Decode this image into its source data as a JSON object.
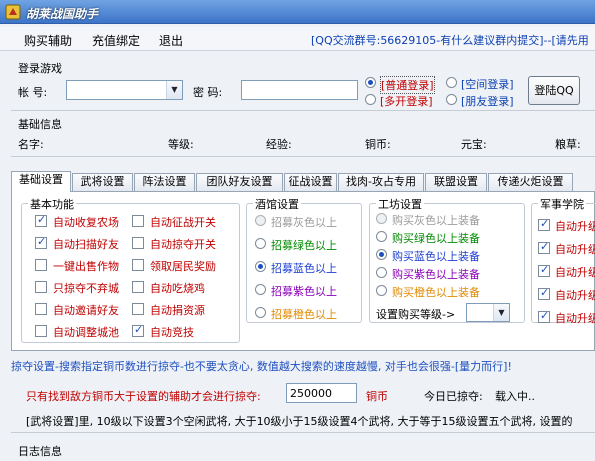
{
  "window": {
    "title": "胡莱战国助手"
  },
  "menu": {
    "items": [
      "购买辅助",
      "充值绑定",
      "退出"
    ],
    "qq_info": "[QQ交流群号:56629105-有什么建议群内提交]--[请先用"
  },
  "login": {
    "section": "登录游戏",
    "account_label": "帐  号:",
    "password_label": "密  码:",
    "options": [
      {
        "label": "[普通登录]",
        "selected": true,
        "color": "#c00000"
      },
      {
        "label": "[多开登录]",
        "selected": false,
        "color": "#c00000"
      },
      {
        "label": "[空间登录]",
        "selected": false,
        "color": "#0b3fb0"
      },
      {
        "label": "[朋友登录]",
        "selected": false,
        "color": "#0b3fb0"
      }
    ],
    "login_button": "登陆QQ"
  },
  "basic_info": {
    "section": "基础信息",
    "fields": [
      "名字:",
      "等级:",
      "经验:",
      "铜币:",
      "元宝:",
      "粮草:"
    ]
  },
  "tabs": [
    "基础设置",
    "武将设置",
    "阵法设置",
    "团队好友设置",
    "征战设置",
    "找肉-攻占专用",
    "联盟设置",
    "传递火炬设置"
  ],
  "basic_functions": {
    "title": "基本功能",
    "col1": [
      {
        "label": "自动收复农场",
        "checked": true
      },
      {
        "label": "自动扫描好友",
        "checked": true
      },
      {
        "label": "一键出售作物",
        "checked": false
      },
      {
        "label": "只掠夺不弃城",
        "checked": false
      },
      {
        "label": "自动邀请好友",
        "checked": false
      },
      {
        "label": "自动调整城池",
        "checked": false
      }
    ],
    "col2": [
      {
        "label": "自动征战开关",
        "checked": false
      },
      {
        "label": "自动掠夺开关",
        "checked": false
      },
      {
        "label": "领取居民奖励",
        "checked": false
      },
      {
        "label": "自动吃烧鸡",
        "checked": false
      },
      {
        "label": "自动捐资源",
        "checked": false
      },
      {
        "label": "自动竞技",
        "checked": true
      }
    ]
  },
  "tavern": {
    "title": "酒馆设置",
    "options": [
      {
        "label": "招募灰色以上",
        "color": "#9a9a9a",
        "selected": false,
        "disabled": true
      },
      {
        "label": "招募绿色以上",
        "color": "#008a00",
        "selected": false,
        "disabled": false
      },
      {
        "label": "招募蓝色以上",
        "color": "#1d3fd0",
        "selected": true,
        "disabled": false
      },
      {
        "label": "招募紫色以上",
        "color": "#8b00b8",
        "selected": false,
        "disabled": false
      },
      {
        "label": "招募橙色以上",
        "color": "#e08a00",
        "selected": false,
        "disabled": false
      }
    ]
  },
  "workshop": {
    "title": "工坊设置",
    "options": [
      {
        "label": "购买灰色以上装备",
        "color": "#9a9a9a",
        "selected": false,
        "disabled": true
      },
      {
        "label": "购买绿色以上装备",
        "color": "#008a00",
        "selected": false,
        "disabled": false
      },
      {
        "label": "购买蓝色以上装备",
        "color": "#1d3fd0",
        "selected": true,
        "disabled": false
      },
      {
        "label": "购买紫色以上装备",
        "color": "#8b00b8",
        "selected": false,
        "disabled": false
      },
      {
        "label": "购买橙色以上装备",
        "color": "#e08a00",
        "selected": false,
        "disabled": false
      }
    ],
    "level_label": "设置购买等级->"
  },
  "academy": {
    "title": "军事学院",
    "items": [
      {
        "label": "自动升级",
        "checked": true
      },
      {
        "label": "自动升级",
        "checked": true
      },
      {
        "label": "自动升级",
        "checked": true
      },
      {
        "label": "自动升级",
        "checked": true
      },
      {
        "label": "自动升级",
        "checked": true
      }
    ]
  },
  "plunder": {
    "info": "掠夺设置-搜索指定铜币数进行掠夺-也不要太贪心, 数值越大搜索的速度越慢, 对手也会很强-[量力而行]!",
    "condition_label": "只有找到敌方铜币大于设置的辅助才会进行掠夺:",
    "amount": "250000",
    "unit": "铜币",
    "today_label": "今日已掠夺:",
    "today_value": "载入中.."
  },
  "general_info": "[武将设置]里, 10级以下设置3个空闲武将, 大于10级小于15级设置4个武将, 大于等于15级设置五个武将, 设置的",
  "log": {
    "section": "日志信息"
  }
}
